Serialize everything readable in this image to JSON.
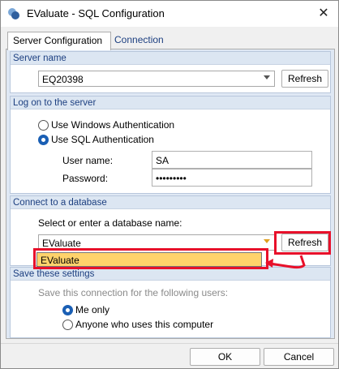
{
  "window": {
    "title": "EValuate - SQL Configuration",
    "close_glyph": "✕"
  },
  "tabs": [
    {
      "label": "Server Configuration",
      "active": true
    },
    {
      "label": "Connection Key",
      "active": false
    }
  ],
  "server_name": {
    "header": "Server name",
    "value": "EQ20398",
    "refresh_label": "Refresh"
  },
  "logon": {
    "header": "Log on to the server",
    "options": [
      {
        "label": "Use Windows Authentication",
        "checked": false
      },
      {
        "label": "Use SQL Authentication",
        "checked": true
      }
    ],
    "username_label": "User name:",
    "username_value": "SA",
    "password_label": "Password:",
    "password_value": "•••••••••"
  },
  "database": {
    "header": "Connect to a database",
    "prompt": "Select or enter a database name:",
    "value": "EValuate",
    "refresh_label": "Refresh",
    "dropdown_items": [
      "EValuate"
    ]
  },
  "save": {
    "header": "Save these settings",
    "prompt": "Save this connection for the following users:",
    "options": [
      {
        "label": "Me only",
        "checked": true
      },
      {
        "label": "Anyone who uses this computer",
        "checked": false
      }
    ]
  },
  "footer": {
    "ok_label": "OK",
    "cancel_label": "Cancel"
  },
  "colors": {
    "highlight": "#e8102a",
    "dropdown_selected": "#ffd36b",
    "group_header": "#dce6f2"
  }
}
